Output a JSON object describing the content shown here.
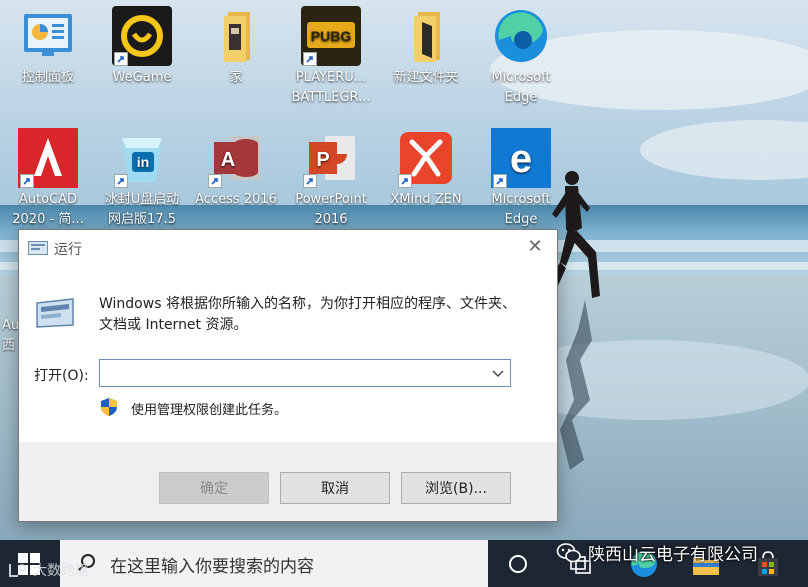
{
  "desktop": {
    "icons": [
      {
        "label": "控制面板",
        "icon": "control-panel-icon"
      },
      {
        "label": "WeGame",
        "icon": "wegame-icon"
      },
      {
        "label": "家",
        "icon": "folder-icon"
      },
      {
        "label": "PLAYERU...\nBATTLEGR...",
        "icon": "pubg-icon"
      },
      {
        "label": "新建文件夹",
        "icon": "folder-icon"
      },
      {
        "label": "Microsoft\nEdge",
        "icon": "edge-new-icon"
      },
      {
        "label": "AutoCAD\n2020 - 简...",
        "icon": "autocad-icon"
      },
      {
        "label": "冰封U盘启动\n网启版17.5",
        "icon": "bingfeng-icon"
      },
      {
        "label": "Access 2016",
        "icon": "access-icon"
      },
      {
        "label": "PowerPoint\n2016",
        "icon": "powerpoint-icon"
      },
      {
        "label": "XMind ZEN",
        "icon": "xmind-icon"
      },
      {
        "label": "Microsoft\nEdge",
        "icon": "edge-legacy-icon"
      }
    ],
    "partial_label": "Au\n西"
  },
  "run_dialog": {
    "title": "运行",
    "description": "Windows 将根据你所输入的名称，为你打开相应的程序、文件夹、文档或 Internet 资源。",
    "open_label": "打开(O):",
    "input_value": "",
    "admin_note": "使用管理权限创建此任务。",
    "buttons": {
      "ok": "确定",
      "cancel": "取消",
      "browse": "浏览(B)..."
    },
    "close_glyph": "✕"
  },
  "taskbar": {
    "search_placeholder": "在这里输入你要搜索的内容"
  },
  "watermarks": {
    "left": "大数跨境",
    "right": "陕西山云电子有限公司"
  },
  "colors": {
    "taskbar": "#1d2733",
    "accent": "#0078d7"
  }
}
